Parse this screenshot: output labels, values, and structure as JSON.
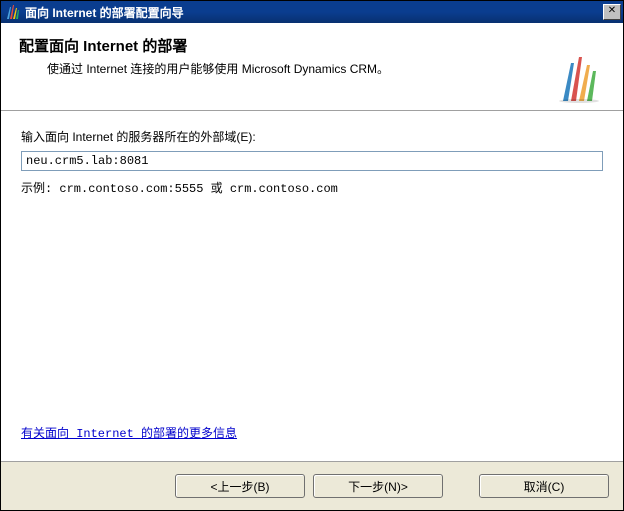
{
  "titlebar": {
    "title": "面向 Internet 的部署配置向导",
    "close_label": "✕"
  },
  "header": {
    "title": "配置面向 Internet 的部署",
    "subtitle": "使通过 Internet 连接的用户能够使用 Microsoft Dynamics CRM。"
  },
  "form": {
    "domain_label": "输入面向 Internet 的服务器所在的外部域(E):",
    "domain_value": "neu.crm5.lab:8081",
    "example_text": "示例: crm.contoso.com:5555 或 crm.contoso.com"
  },
  "link": {
    "more_info": "有关面向 Internet 的部署的更多信息"
  },
  "buttons": {
    "back": "<上一步(B)",
    "next": "下一步(N)>",
    "cancel": "取消(C)"
  },
  "icons": {
    "app": "dynamics-crm-icon",
    "close": "close-icon"
  }
}
